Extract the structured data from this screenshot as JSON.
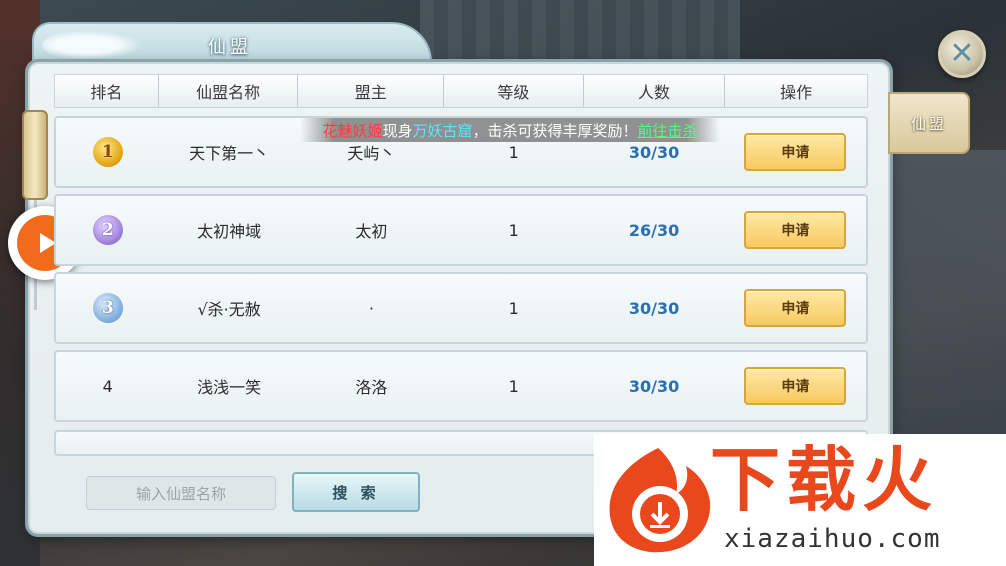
{
  "title": "仙盟",
  "side_tab": "仙盟",
  "columns": [
    "排名",
    "仙盟名称",
    "盟主",
    "等级",
    "人数",
    "操作"
  ],
  "rows": [
    {
      "rank": "1",
      "name": "天下第一丶",
      "leader": "夭屿丶",
      "level": "1",
      "members": "30/30",
      "action": "申请"
    },
    {
      "rank": "2",
      "name": "太初神域",
      "leader": "太初",
      "level": "1",
      "members": "26/30",
      "action": "申请"
    },
    {
      "rank": "3",
      "name": "√杀·无赦",
      "leader": "·",
      "level": "1",
      "members": "30/30",
      "action": "申请"
    },
    {
      "rank": "4",
      "name": "浅浅一笑",
      "leader": "洛洛",
      "level": "1",
      "members": "30/30",
      "action": "申请"
    }
  ],
  "notice": {
    "part1": "花魅妖姬",
    "part2": "现身",
    "part3": "万妖古窟",
    "part4": "，击杀可获得丰厚奖励！",
    "link": "前往击杀"
  },
  "search": {
    "placeholder": "输入仙盟名称",
    "button": "搜 索"
  },
  "watermark": {
    "title": "下载火",
    "url": "xiazaihuo.com"
  },
  "colors": {
    "accent_orange": "#e8481c",
    "member_blue": "#2a6fb0",
    "button_gold": "#f7c960"
  }
}
